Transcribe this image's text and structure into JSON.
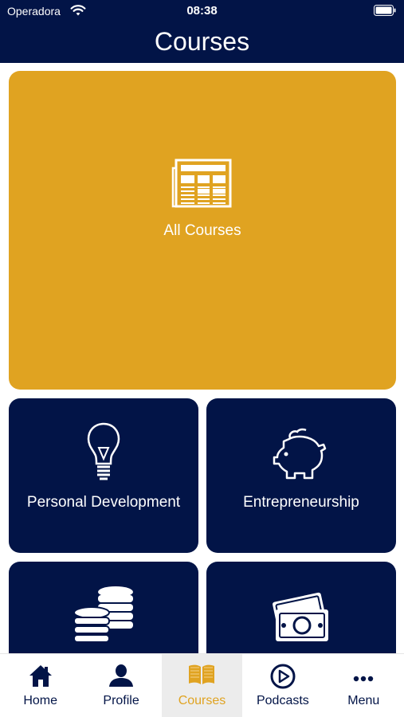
{
  "status_bar": {
    "carrier": "Operadora",
    "time": "08:38"
  },
  "header": {
    "title": "Courses"
  },
  "tiles": [
    {
      "label": "All Courses",
      "icon": "newspaper-icon",
      "color": "#e0a321"
    },
    {
      "label": "Personal Development",
      "icon": "lightbulb-icon",
      "color": "#021447"
    },
    {
      "label": "Entrepreneurship",
      "icon": "piggy-bank-icon",
      "color": "#021447"
    },
    {
      "label": "",
      "icon": "coins-icon",
      "color": "#021447"
    },
    {
      "label": "",
      "icon": "money-icon",
      "color": "#021447"
    }
  ],
  "tab_bar": {
    "items": [
      {
        "label": "Home",
        "icon": "home-icon"
      },
      {
        "label": "Profile",
        "icon": "user-icon"
      },
      {
        "label": "Courses",
        "icon": "book-icon",
        "active": true
      },
      {
        "label": "Podcasts",
        "icon": "play-circle-icon"
      },
      {
        "label": "Menu",
        "icon": "more-dots-icon"
      }
    ],
    "active_color": "#e0a321",
    "color": "#021447"
  }
}
